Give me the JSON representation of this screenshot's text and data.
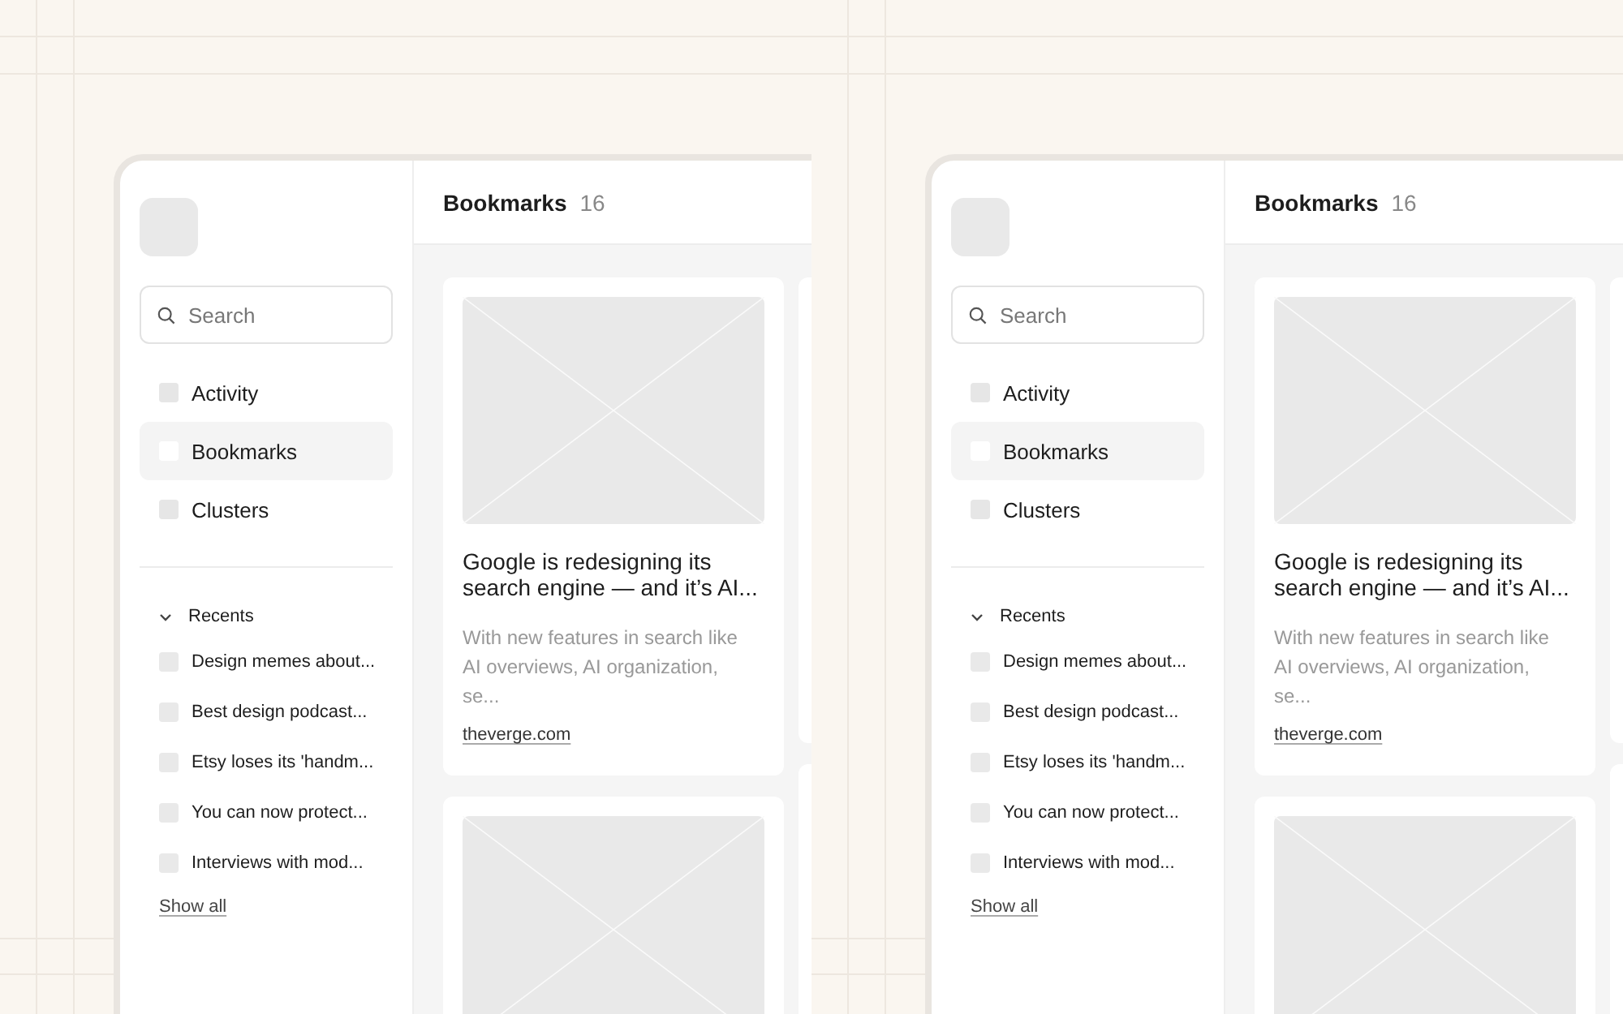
{
  "panels": [
    {
      "search": {
        "placeholder": "Search"
      },
      "nav": [
        {
          "label": "Activity",
          "selected": false
        },
        {
          "label": "Bookmarks",
          "selected": true
        },
        {
          "label": "Clusters",
          "selected": false
        }
      ],
      "recents": {
        "label": "Recents",
        "expanded": true,
        "items": [
          "Design memes about...",
          "Best design podcast...",
          "Etsy loses its 'handm...",
          "You can now protect...",
          "Interviews with mod..."
        ],
        "show_all": "Show all"
      },
      "header": {
        "title": "Bookmarks",
        "count": "16"
      },
      "cards": [
        {
          "kind": "article",
          "title": "Google is redesigning its search engine — and it’s AI...",
          "description": "With new features in search like AI overviews, AI organization, se...",
          "source": "theverge.com"
        },
        {
          "kind": "placeholder"
        }
      ]
    },
    {
      "search": {
        "placeholder": "Search"
      },
      "nav": [
        {
          "label": "Activity",
          "selected": false
        },
        {
          "label": "Bookmarks",
          "selected": true
        },
        {
          "label": "Clusters",
          "selected": false
        }
      ],
      "recents": {
        "label": "Recents",
        "expanded": true,
        "items": [
          "Design memes about...",
          "Best design podcast...",
          "Etsy loses its 'handm...",
          "You can now protect...",
          "Interviews with mod..."
        ],
        "show_all": "Show all"
      },
      "header": {
        "title": "Bookmarks",
        "count": "16"
      },
      "cards": [
        {
          "kind": "article",
          "title": "Google is redesigning its search engine — and it’s AI...",
          "description": "With new features in search like AI overviews, AI organization, se...",
          "source": "theverge.com"
        },
        {
          "kind": "placeholder"
        }
      ]
    }
  ]
}
